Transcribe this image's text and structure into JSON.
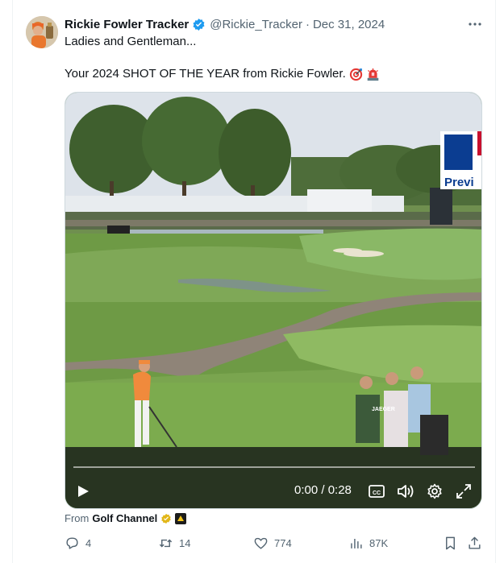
{
  "tweet": {
    "author_name": "Rickie Fowler Tracker",
    "handle": "@Rickie_Tracker",
    "separator": "·",
    "date": "Dec 31, 2024",
    "line1": "Ladies and Gentleman...",
    "line2": "Your 2024 SHOT OF THE YEAR from Rickie Fowler.",
    "emojis": [
      "target-emoji",
      "siren-emoji"
    ]
  },
  "video": {
    "time": "0:00 / 0:28",
    "progress": 0,
    "overlay_text": "Previ",
    "player_labels": [
      "JAEGER"
    ]
  },
  "source": {
    "prefix": "From",
    "name": "Golf Channel"
  },
  "actions": {
    "replies": "4",
    "retweets": "14",
    "likes": "774",
    "views": "87K"
  },
  "colors": {
    "text_primary": "#0f1419",
    "text_secondary": "#536471",
    "verified_blue": "#1d9bf0",
    "border": "#cfd9de",
    "fairway": "#7fa857",
    "shirt_orange": "#f08a3c"
  }
}
